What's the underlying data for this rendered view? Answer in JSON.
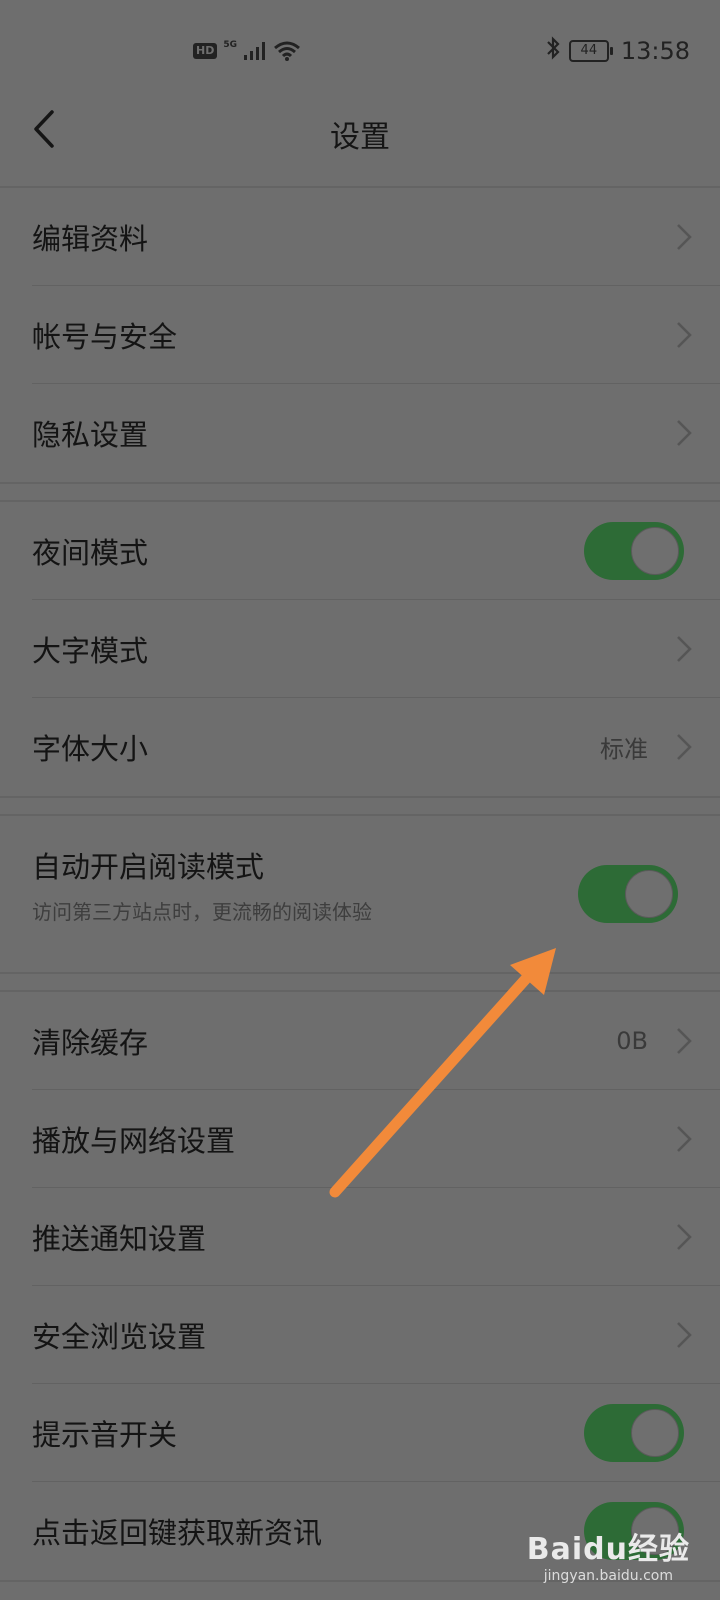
{
  "status_bar": {
    "hd": "HD",
    "network": "5G",
    "battery": "44",
    "time": "13:58"
  },
  "header": {
    "title": "设置"
  },
  "group1": [
    {
      "label": "编辑资料"
    },
    {
      "label": "帐号与安全"
    },
    {
      "label": "隐私设置"
    }
  ],
  "group2": {
    "night_mode": {
      "label": "夜间模式",
      "enabled": true
    },
    "large_text": {
      "label": "大字模式"
    },
    "font_size": {
      "label": "字体大小",
      "value": "标准"
    }
  },
  "reading_mode": {
    "label": "自动开启阅读模式",
    "description": "访问第三方站点时，更流畅的阅读体验",
    "enabled": true
  },
  "group4": {
    "clear_cache": {
      "label": "清除缓存",
      "value": "0B"
    },
    "playback_network": {
      "label": "播放与网络设置"
    },
    "push_notifications": {
      "label": "推送通知设置"
    },
    "safe_browsing": {
      "label": "安全浏览设置"
    },
    "sound_toggle": {
      "label": "提示音开关",
      "enabled": true
    },
    "back_refresh": {
      "label": "点击返回键获取新资讯",
      "enabled": true
    }
  },
  "watermark": {
    "logo": "Baidu经验",
    "url": "jingyan.baidu.com"
  },
  "colors": {
    "toggle_on": "#2d6b36",
    "arrow": "#f28a3a",
    "overlay_bg": "#6e6e6e"
  },
  "icons": [
    "back-arrow-icon",
    "chevron-right-icon",
    "bluetooth-icon",
    "wifi-icon",
    "signal-icon"
  ]
}
